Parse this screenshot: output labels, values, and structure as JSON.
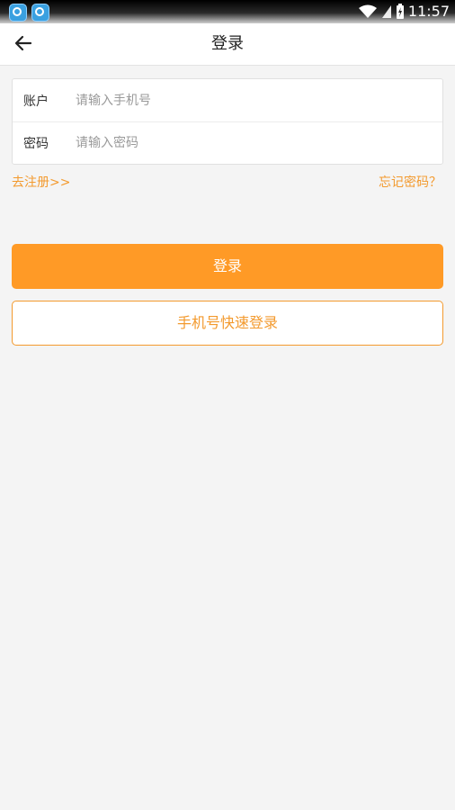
{
  "status_bar": {
    "time": "11:57",
    "icons": [
      "app-icon",
      "app-icon",
      "wifi-icon",
      "signal-icon",
      "battery-charging-icon"
    ]
  },
  "header": {
    "title": "登录",
    "back_icon": "arrow-left-icon"
  },
  "form": {
    "account": {
      "label": "账户",
      "placeholder": "请输入手机号",
      "value": ""
    },
    "password": {
      "label": "密码",
      "placeholder": "请输入密码",
      "value": ""
    }
  },
  "links": {
    "register": "去注册>>",
    "forgot": "忘记密码？"
  },
  "buttons": {
    "login": "登录",
    "quick_login": "手机号快速登录"
  },
  "colors": {
    "accent": "#ff9a26",
    "background": "#f4f4f4"
  }
}
